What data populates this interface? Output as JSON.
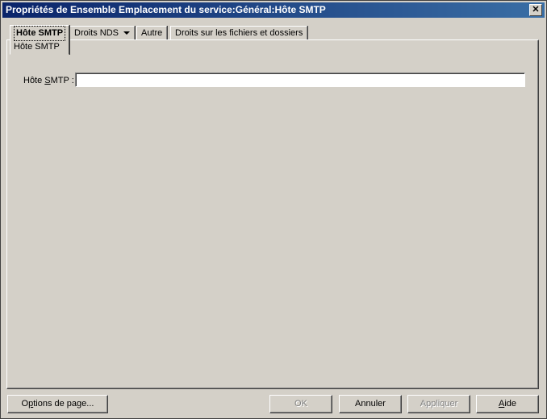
{
  "window": {
    "title": "Propriétés de Ensemble Emplacement du service:Général:Hôte SMTP",
    "close_symbol": "✕"
  },
  "tabs": [
    {
      "label": "Hôte SMTP",
      "sublabel": "Hôte SMTP",
      "active": true
    },
    {
      "label": "Droits NDS",
      "has_dropdown": true
    },
    {
      "label": "Autre"
    },
    {
      "label": "Droits sur les fichiers et dossiers"
    }
  ],
  "form": {
    "smtp_host": {
      "label_pre": "Hôte ",
      "label_ul": "S",
      "label_post": "MTP :",
      "value": ""
    }
  },
  "buttons": {
    "page_options": {
      "pre": "O",
      "ul": "p",
      "post": "tions de page..."
    },
    "ok": "OK",
    "cancel": "Annuler",
    "apply": "Appliquer",
    "help": {
      "ul": "A",
      "post": "ide"
    }
  },
  "colors": {
    "face": "#d4d0c8",
    "title_start": "#0a246a",
    "title_end": "#3a6ea5"
  },
  "icons": {
    "close": "close-icon",
    "dropdown": "chevron-down-icon"
  }
}
